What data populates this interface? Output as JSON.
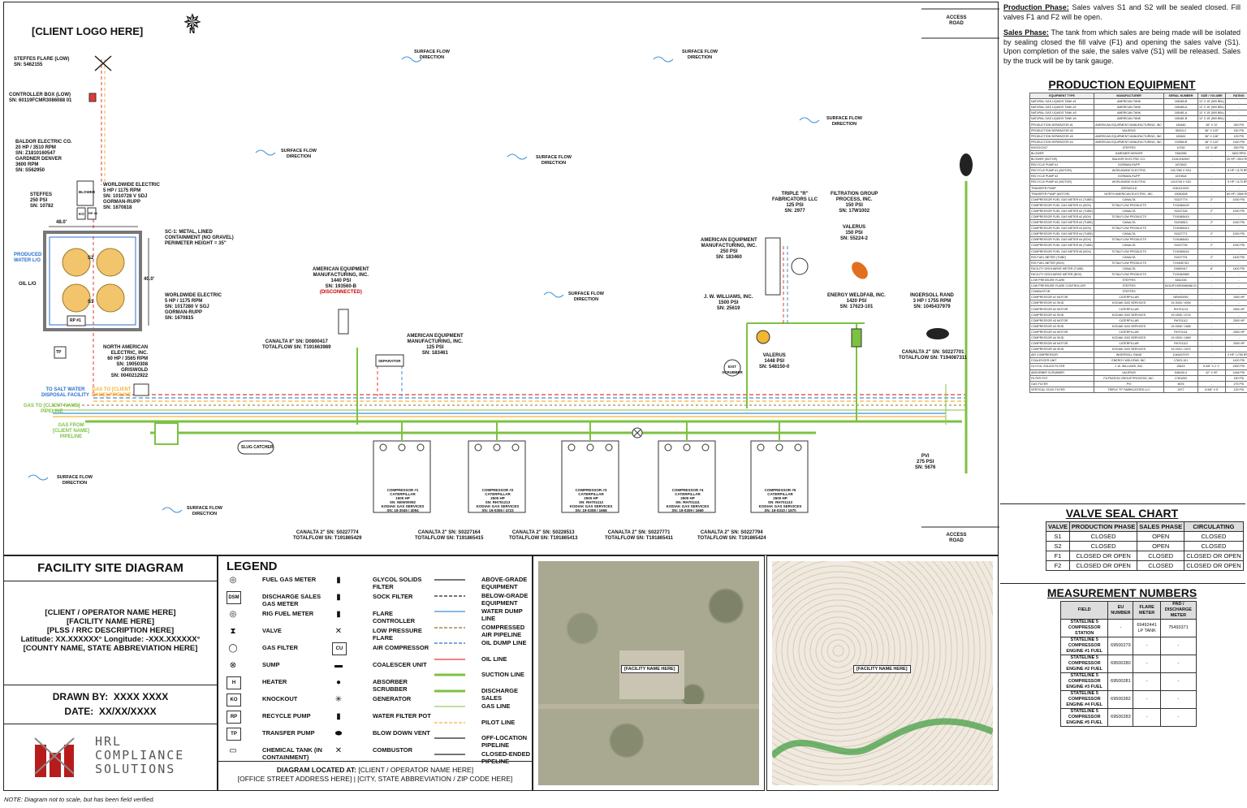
{
  "header": {
    "client_logo": "[CLIENT LOGO HERE]",
    "north": "N",
    "access_road_top": "ACCESS ROAD",
    "access_road_bottom": "ACCESS ROAD"
  },
  "notes": {
    "production_label": "Production Phase:",
    "production_text": "Sales valves S1 and S2 will be sealed closed. Fill valves F1 and F2 will be open.",
    "sales_label": "Sales Phase:",
    "sales_text": "The tank from which sales are being made will be isolated by sealing closed the fill valve (F1) and opening the sales valve (S1). Upon completion of the sale, the sales valve (S1) will be released. Sales by the truck will be by tank gauge."
  },
  "production_equipment": {
    "title": "PRODUCTION EQUIPMENT",
    "headers": [
      "EQUIPMENT TYPE",
      "MANUFACTURER",
      "SERIAL NUMBER",
      "SIZE / VOLUME",
      "RATING"
    ],
    "rows": [
      [
        "NATURAL GAS LIQUIDS TANK #1",
        "AMERICAN TANK",
        "185480-B",
        "12' X 15' (500 BBL)",
        "-"
      ],
      [
        "NATURAL GAS LIQUIDS TANK #2",
        "AMERICAN TANK",
        "185480-A",
        "12' X 15' (500 BBL)",
        "-"
      ],
      [
        "NATURAL GAS LIQUIDS TANK #3",
        "AMERICAN TANK",
        "185481-A",
        "12' X 15' (500 BBL)",
        "-"
      ],
      [
        "NATURAL GAS LIQUIDS TANK #4",
        "AMERICAN TANK",
        "185481-B",
        "12' X 15' (500 BBL)",
        "-"
      ],
      [
        "PRODUCTION SEPARATOR #1",
        "AMERICAN EQUIPMENT MANUFACTURING, INC.",
        "183460",
        "36\" X 10'",
        "250 PSI"
      ],
      [
        "PRODUCTION SEPARATOR #2",
        "VALERUS",
        "55224-2",
        "36\" X 120\"",
        "150 PSI"
      ],
      [
        "PRODUCTION SEPARATOR #3",
        "AMERICAN EQUIPMENT MANUFACTURING, INC.",
        "183461",
        "36\" X 108\"",
        "125 PSI"
      ],
      [
        "PRODUCTION SEPARATOR #4",
        "AMERICAN EQUIPMENT MANUFACTURING, INC.",
        "193560-B",
        "48\" X 120\"",
        "1440 PSI"
      ],
      [
        "KNOCKOUT",
        "STEFFES",
        "10782",
        "24\" X 48\"",
        "250 PSI"
      ],
      [
        "BLOWER",
        "GARDNER DENVER",
        "S562950",
        "-",
        "3600 RPM"
      ],
      [
        "BLOWER (MOTOR)",
        "BALDOR ELECTRIC CO.",
        "Z1810160547",
        "-",
        "20 HP / 3510 RPM"
      ],
      [
        "RECYCLE PUMP #1",
        "GORMAN-RUPP",
        "1670815",
        "-",
        "-"
      ],
      [
        "RECYCLE PUMP #1 (MOTOR)",
        "WORLDWIDE ELECTRIC",
        "1017280 V SGJ",
        "-",
        "5 HP / 1175 RPM"
      ],
      [
        "RECYCLE PUMP #2",
        "GORMAN-RUPP",
        "1670818",
        "-",
        "-"
      ],
      [
        "RECYCLE PUMP #2 (MOTOR)",
        "WORLDWIDE ELECTRIC",
        "1010728 V SDJ",
        "-",
        "5 HP / 1175 RPM"
      ],
      [
        "TRANSFER PUMP",
        "GRISWOLD",
        "0040212922",
        "-",
        "-"
      ],
      [
        "TRANSFER PUMP (MOTOR)",
        "NORTH AMERICAN ELECTRIC, INC.",
        "19050308",
        "-",
        "60 HP / 3565 RPM"
      ],
      [
        "COMPRESSOR FUEL GAS METER #1 (TUBE)",
        "CANALTA",
        "S0227774",
        "2\"",
        "1000 PSI"
      ],
      [
        "COMPRESSOR FUEL GAS METER #1 (BOX)",
        "TOTALFLOW PRODUCTS",
        "T191865429",
        "-",
        "-"
      ],
      [
        "COMPRESSOR FUEL GAS METER #2 (TUBE)",
        "CANALTA",
        "S0227164",
        "2\"",
        "1000 PSI"
      ],
      [
        "COMPRESSOR FUEL GAS METER #2 (BOX)",
        "TOTALFLOW PRODUCTS",
        "T191865415",
        "-",
        "-"
      ],
      [
        "COMPRESSOR FUEL GAS METER #3 (TUBE)",
        "CANALTA",
        "S0228513",
        "2\"",
        "1000 PSI"
      ],
      [
        "COMPRESSOR FUEL GAS METER #3 (BOX)",
        "TOTALFLOW PRODUCTS",
        "T191865413",
        "-",
        "-"
      ],
      [
        "COMPRESSOR FUEL GAS METER #4 (TUBE)",
        "CANALTA",
        "S0227771",
        "2\"",
        "1000 PSI"
      ],
      [
        "COMPRESSOR FUEL GAS METER #4 (BOX)",
        "TOTALFLOW PRODUCTS",
        "T191865411",
        "-",
        "-"
      ],
      [
        "COMPRESSOR FUEL GAS METER #5 (TUBE)",
        "CANALTA",
        "S0227794",
        "2\"",
        "1000 PSI"
      ],
      [
        "COMPRESSOR FUEL GAS METER #5 (BOX)",
        "TOTALFLOW PRODUCTS",
        "T191865424",
        "-",
        "-"
      ],
      [
        "RIG FUEL METER (TUBE)",
        "CANALTA",
        "S0227701",
        "2\"",
        "1400 PSI"
      ],
      [
        "RIG FUEL METER (BOX)",
        "TOTALFLOW PRODUCTS",
        "T194087311",
        "-",
        "-"
      ],
      [
        "FACILITY DISCHARGE METER (TUBE)",
        "CANALTA",
        "D0800417",
        "8\"",
        "1400 PSI"
      ],
      [
        "FACILITY DISCHARGE METER (BOX)",
        "TOTALFLOW PRODUCTS",
        "T191663989",
        "-",
        "-"
      ],
      [
        "LOW PRESSURE FLARE",
        "STEFFES",
        "5462155",
        "-",
        "-"
      ],
      [
        "LOW PRESSURE FLARE CONTROLLER",
        "STEFFES",
        "60119FCMR3086088 01",
        "-",
        "-"
      ],
      [
        "COMBUSTOR",
        "STEFFES",
        "-",
        "-",
        "-"
      ],
      [
        "COMPRESSOR #1 MOTOR",
        "CATERPILLAR",
        "NEW00092",
        "-",
        "1500 HP"
      ],
      [
        "COMPRESSOR #1 SKID",
        "KODIAK GAS SERVICES",
        "19-3045 / 4094",
        "-",
        "-"
      ],
      [
        "COMPRESSOR #2 MOTOR",
        "CATERPILLAR",
        "RH701213",
        "-",
        "2500 HP"
      ],
      [
        "COMPRESSOR #2 SKID",
        "KODIAK GAS SERVICES",
        "19-0306 / 4723",
        "-",
        "-"
      ],
      [
        "COMPRESSOR #3 MOTOR",
        "CATERPILLAR",
        "RH701112",
        "-",
        "2500 HP"
      ],
      [
        "COMPRESSOR #3 SKID",
        "KODIAK GAS SERVICES",
        "19-0308 / 1668",
        "-",
        "-"
      ],
      [
        "COMPRESSOR #4 MOTOR",
        "CATERPILLAR",
        "RH701111",
        "-",
        "2500 HP"
      ],
      [
        "COMPRESSOR #4 SKID",
        "KODIAK GAS SERVICES",
        "19-0309 / 1669",
        "-",
        "-"
      ],
      [
        "COMPRESSOR #5 MOTOR",
        "CATERPILLAR",
        "RH701113",
        "-",
        "2500 HP"
      ],
      [
        "COMPRESSOR #5 SKID",
        "KODIAK GAS SERVICES",
        "19-0310 / 1670",
        "-",
        "-"
      ],
      [
        "AIR COMPRESSOR",
        "INGERSOLL RAND",
        "1045437979",
        "-",
        "3 HP / 1755 RPM"
      ],
      [
        "COALESCER UNIT",
        "ENERGY WELDFAB, INC.",
        "17623-101",
        "-",
        "1420 PSI"
      ],
      [
        "GLYCOL SOLIDS FILTER",
        "J. W. WILLIAMS, INC.",
        "25619",
        "8 5/8\" X 2' 1\"",
        "1500 PSI"
      ],
      [
        "ABSORBER SCRUBBER",
        "VALERUS",
        "548150-0",
        "42\" X 90\"",
        "1448 PSI"
      ],
      [
        "FILTER POT",
        "FILTRATION GROUP PROCESS, INC.",
        "17W1002",
        "-",
        "150 PSI"
      ],
      [
        "GAS FILTER",
        "PVI",
        "5676",
        "-",
        "275 PSI"
      ],
      [
        "VERTICAL SOCK FILTER",
        "TRIPLE \"R\" FABRICATORS LLC",
        "2977",
        "8 5/8\" X 5'",
        "125 PSI"
      ]
    ]
  },
  "valve_seal_chart": {
    "title": "VALVE SEAL CHART",
    "headers": [
      "VALVE",
      "PRODUCTION PHASE",
      "SALES PHASE",
      "CIRCULATING"
    ],
    "rows": [
      [
        "S1",
        "CLOSED",
        "OPEN",
        "CLOSED"
      ],
      [
        "S2",
        "CLOSED",
        "OPEN",
        "CLOSED"
      ],
      [
        "F1",
        "CLOSED OR OPEN",
        "CLOSED",
        "CLOSED OR OPEN"
      ],
      [
        "F2",
        "CLOSED OR OPEN",
        "CLOSED",
        "CLOSED OR OPEN"
      ]
    ]
  },
  "measurement_numbers": {
    "title": "MEASUREMENT NUMBERS",
    "headers": [
      "FIELD",
      "EU NUMBER",
      "FLARE METER",
      "PAD / DISCHARGE METER"
    ],
    "rows": [
      [
        "STATELINE 5 COMPRESSOR STATION",
        "-",
        "69492441 LP TANK",
        "75493371"
      ],
      [
        "STATELINE 5 COMPRESSOR ENGINE #1 FUEL",
        "69500279",
        "-",
        "-"
      ],
      [
        "STATELINE 5 COMPRESSOR ENGINE #2 FUEL",
        "69500280",
        "-",
        "-"
      ],
      [
        "STATELINE 5 COMPRESSOR ENGINE #3 FUEL",
        "69500281",
        "-",
        "-"
      ],
      [
        "STATELINE 5 COMPRESSOR ENGINE #4 FUEL",
        "69500282",
        "-",
        "-"
      ],
      [
        "STATELINE 5 COMPRESSOR ENGINE #5 FUEL",
        "69500283",
        "-",
        "-"
      ]
    ]
  },
  "site_labels": {
    "steffes_flare": [
      "STEFFES FLARE (LOW)",
      "SN: 5462155"
    ],
    "controller_box": [
      "CONTROLLER BOX (LOW)",
      "SN: 60119FCMR3086088 01"
    ],
    "baldor": [
      "BALDOR ELECTRIC CO.",
      "20 HP / 3510 RPM",
      "SN: Z1810160547",
      "GARDNER DENVER",
      "3600 RPM",
      "SN: S562950"
    ],
    "steffes_ko": [
      "STEFFES",
      "250 PSI",
      "SN: 10782"
    ],
    "worldwide_1": [
      "WORLDWIDE ELECTRIC",
      "5 HP / 1175 RPM",
      "SN: 1010728 V SDJ",
      "GORMAN-RUPP",
      "SN: 1670818"
    ],
    "worldwide_2": [
      "WORLDWIDE ELECTRIC",
      "5 HP / 1175 RPM",
      "SN: 1017280 V SGJ",
      "GORMAN-RUPP",
      "SN: 1670815"
    ],
    "containment": [
      "SC-1: METAL, LINED",
      "CONTAINMENT (NO GRAVEL)",
      "PERIMETER HEIGHT = 35\""
    ],
    "north_american": [
      "NORTH AMERICAN",
      "ELECTRIC, INC.",
      "60 HP / 3565 RPM",
      "SN: 19050308",
      "GRISWOLD",
      "SN: 0040212922"
    ],
    "produced_water": "PRODUCED WATER L/O",
    "oil_lo": "OIL L/O",
    "dim_48_top": "48.0'",
    "dim_40": "40.0'",
    "dim_48_left": "48.0'",
    "blower": "BLOWER",
    "rp1": "RP #1",
    "rp2": "RP #2",
    "ko": "KO",
    "tp": "TP",
    "tank_s2": "S2",
    "tank_s1": "S1",
    "to_salt_water": [
      "TO SALT WATER",
      "DISPOSAL FACILITY"
    ],
    "gas_to_client": [
      "GAS TO [CLIENT",
      "NAME] PIPELINE"
    ],
    "gas_to_client_2": [
      "GAS TO [CLIENT NAME]",
      "PIPELINE"
    ],
    "gas_from_client": [
      "GAS FROM",
      "[CLIENT NAME]",
      "PIPELINE"
    ],
    "slug_catcher": "SLUG CATCHER",
    "canalta_8": [
      "CANALTA 8\" SN: D0800417",
      "TOTALFLOW SN: T191663989"
    ],
    "ae_1440": [
      "AMERICAN EQUIPMENT",
      "MANUFACTURING, INC.",
      "1440 PSI",
      "SN: 193560-B"
    ],
    "ae_1440_disc": "(DISCONNECTED)",
    "ae_125": [
      "AMERICAN EQUIPMENT",
      "MANUFACTURING, INC.",
      "125 PSI",
      "SN: 183461"
    ],
    "ae_250": [
      "AMERICAN EQUIPMENT",
      "MANUFACTURING, INC.",
      "250 PSI",
      "SN: 183460"
    ],
    "separator": "SEPARATOR",
    "triple_r": [
      "TRIPLE \"R\"",
      "FABRICATORS LLC",
      "125 PSI",
      "SN: 2977"
    ],
    "filtration": [
      "FILTRATION GROUP",
      "PROCESS, INC.",
      "150 PSI",
      "SN: 17W1002"
    ],
    "valerus_150": [
      "VALERUS",
      "150 PSI",
      "SN: 55224-2"
    ],
    "jw_williams": [
      "J. W. WILLIAMS, INC.",
      "1500 PSI",
      "SN: 25619"
    ],
    "energy_weldfab": [
      "ENERGY WELDFAB, INC.",
      "1420 PSI",
      "SN: 17623-101"
    ],
    "ingersoll": [
      "INGERSOLL RAND",
      "3 HP / 1755 RPM",
      "SN: 1045437979"
    ],
    "valerus_1448": [
      "VALERUS",
      "1448 PSI",
      "SN: 548150-0"
    ],
    "canalta_rig": [
      "CANALTA 2\" SN: S0227701",
      "TOTALFLOW SN: T194087311"
    ],
    "pvi": [
      "PVI",
      "275 PSI",
      "SN: 5676"
    ],
    "exit_scrubber": "EXIT SCRUBBER",
    "compressors": [
      {
        "name": "COMPRESSOR #1",
        "mfr": "CATERPILLAR",
        "hp": "1500 HP",
        "sn": "SN: NEW00092",
        "skid": "KODIAK GAS SERVICES",
        "skid_sn": "SN: 19-3045 / 4094",
        "meter": "CANALTA 2\" SN: S0227774",
        "flow": "TOTALFLOW SN: T191865429"
      },
      {
        "name": "COMPRESSOR #2",
        "mfr": "CATERPILLAR",
        "hp": "2500 HP",
        "sn": "SN: RH701213",
        "skid": "KODIAK GAS SERVICES",
        "skid_sn": "SN: 19-0306 / 4723",
        "meter": "CANALTA 2\" SN: S0227164",
        "flow": "TOTALFLOW SN: T191865415"
      },
      {
        "name": "COMPRESSOR #3",
        "mfr": "CATERPILLAR",
        "hp": "2500 HP",
        "sn": "SN: RH701112",
        "skid": "KODIAK GAS SERVICES",
        "skid_sn": "SN: 19-0308 / 1668",
        "meter": "CANALTA 2\" SN: S0228513",
        "flow": "TOTALFLOW SN: T191865413"
      },
      {
        "name": "COMPRESSOR #4",
        "mfr": "CATERPILLAR",
        "hp": "2500 HP",
        "sn": "SN: RH701111",
        "skid": "KODIAK GAS SERVICES",
        "skid_sn": "SN: 19-0309 / 1669",
        "meter": "CANALTA 2\" SN: S0227771",
        "flow": "TOTALFLOW SN: T191865411"
      },
      {
        "name": "COMPRESSOR #5",
        "mfr": "CATERPILLAR",
        "hp": "2500 HP",
        "sn": "SN: RH701113",
        "skid": "KODIAK GAS SERVICES",
        "skid_sn": "SN: 19-0310 / 1670",
        "meter": "CANALTA 2\" SN: S0227794",
        "flow": "TOTALFLOW SN: T191865424"
      }
    ],
    "surface_flow": "SURFACE FLOW DIRECTION"
  },
  "title_block": {
    "title": "FACILITY SITE DIAGRAM",
    "client": "[CLIENT / OPERATOR NAME HERE]",
    "facility": "[FACILITY NAME HERE]",
    "plss": "[PLSS / RRC DESCRIPTION HERE]",
    "latlon": "Latitude: XX.XXXXXX° Longitude: -XXX.XXXXXX°",
    "county": "[COUNTY NAME, STATE ABBREVIATION HERE]",
    "drawn_by_label": "DRAWN BY:",
    "drawn_by": "XXXX XXXX",
    "date_label": "DATE:",
    "date": "XX/XX/XXXX",
    "logo_line1": "HRL",
    "logo_line2": "COMPLIANCE",
    "logo_line3": "SOLUTIONS"
  },
  "legend": {
    "title": "LEGEND",
    "items": [
      "FUEL GAS METER",
      "DISCHARGE SALES GAS METER",
      "RIG FUEL METER",
      "VALVE",
      "GAS FILTER",
      "SUMP",
      "HEATER",
      "KNOCKOUT",
      "RECYCLE PUMP",
      "TRANSFER PUMP",
      "CHEMICAL TANK (IN CONTAINMENT)",
      "GLYCOL SOLIDS FILTER",
      "SOCK FILTER",
      "FLARE CONTROLLER",
      "LOW PRESSURE FLARE",
      "AIR COMPRESSOR",
      "COALESCER UNIT",
      "ABSORBER SCRUBBER",
      "GENERATOR",
      "WATER FILTER POT",
      "BLOW DOWN VENT",
      "COMBUSTOR",
      "ABOVE-GRADE EQUIPMENT",
      "BELOW-GRADE EQUIPMENT",
      "WATER DUMP LINE",
      "COMPRESSED AIR PIPELINE",
      "OIL DUMP LINE",
      "OIL LINE",
      "SUCTION LINE",
      "DISCHARGE SALES",
      "GAS LINE",
      "PILOT LINE",
      "OFF-LOCATION PIPELINE",
      "CLOSED-ENDED PIPELINE"
    ],
    "icon_texts": [
      "DSM",
      "H",
      "KO",
      "RP",
      "TP",
      "CU"
    ],
    "colors": {
      "water": "#3a8fd6",
      "air": "#9b6b2e",
      "oil_dump": "#2a6fc9",
      "oil": "#e53935",
      "suction": "#7cc242",
      "discharge": "#7cc242",
      "gas": "#9ccc65",
      "pilot": "#f2b632"
    }
  },
  "location": {
    "label": "DIAGRAM LOCATED AT:",
    "text": "[CLIENT / OPERATOR NAME HERE]",
    "address": "[OFFICE STREET ADDRESS HERE] | [CITY, STATE ABBREVIATION / ZIP CODE HERE]",
    "map_tag": "[FACILITY NAME HERE]"
  },
  "footer_note": "NOTE: Diagram not to scale, but has been field verified."
}
